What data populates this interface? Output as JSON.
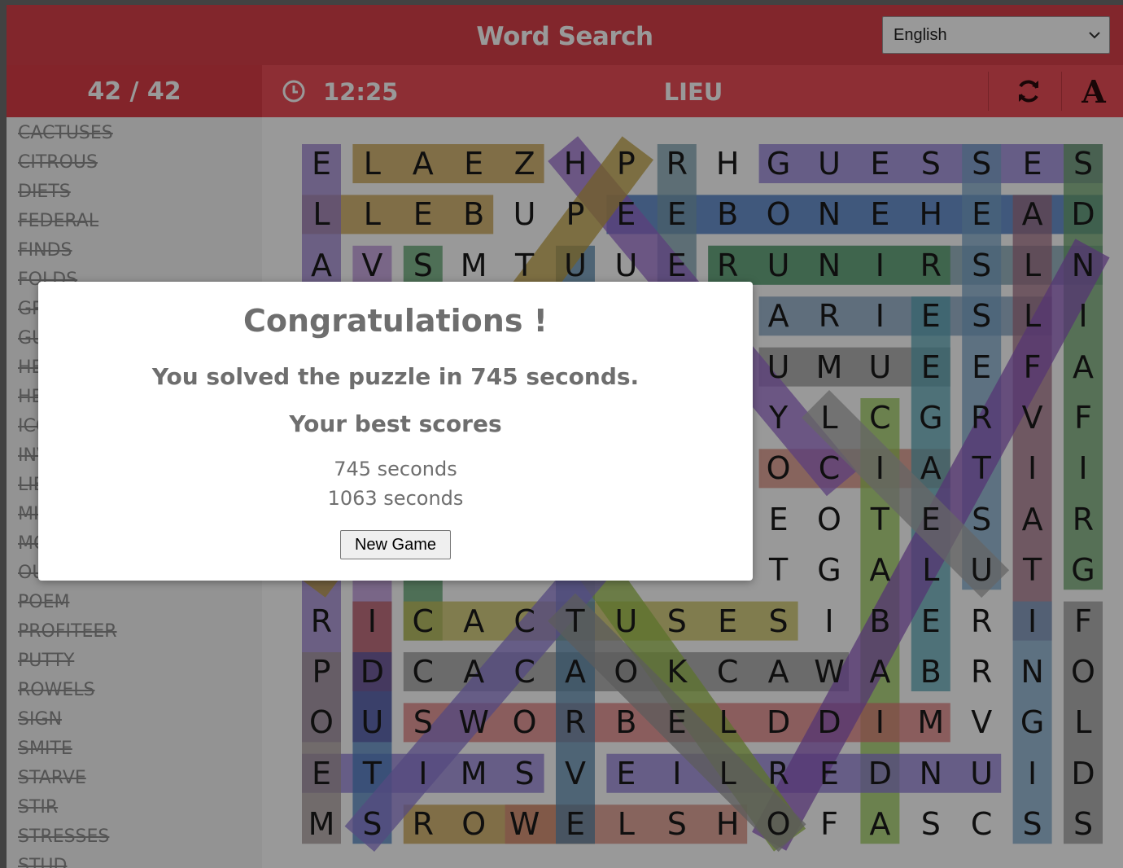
{
  "app": {
    "title": "Word Search"
  },
  "language": {
    "selected": "English"
  },
  "status": {
    "counter": "42 / 42",
    "timer": "12:25",
    "current_word": "LIEU"
  },
  "icons": {
    "clock": "clock-icon",
    "refresh": "refresh-icon",
    "font": "font-size-icon",
    "chevron": "chevron-down-icon"
  },
  "font_button": {
    "label": "A"
  },
  "colors": {
    "header": "#d9404a",
    "counter_bar": "#da3d47",
    "control_bar": "#ec4e57"
  },
  "word_list": [
    "CACTUSES",
    "CITROUS",
    "DIETS",
    "FEDERAL",
    "FINDS",
    "FOLDS",
    "GRIMACE",
    "GUESSES",
    "HEADING",
    "HEAVEN",
    "ICONS",
    "INVITE",
    "LIEU",
    "MIDDLE",
    "MOIST",
    "OUTLET",
    "POEM",
    "PROFITEER",
    "PUTTY",
    "ROWELS",
    "SIGN",
    "SMITE",
    "STARVE",
    "STIR",
    "STRESSES",
    "STUD"
  ],
  "grid": [
    "ELAEZHPRHGUESSES",
    "LLEBUPEEBONEHEAD",
    "AVSMTUUERUNIRSLN",
    "JMSCSQVIGARIESLI",
    "OMTUTIRRLUMUEEFA",
    "SNEIOQIEQYLCGRVF",
    "BVEBQMTSSOCIATII",
    "DTQXPOMEIEOTESAR",
    "HMDFLENTITGALUTG",
    "RICACTUSESIBERIF",
    "PDCACAOKCAWABRNO",
    "OUSWORBELDDIMVGL",
    "ETIMSVEILREDNUID",
    "MSROWELSHOFASCSS"
  ],
  "modal": {
    "title": "Congratulations !",
    "message": "You solved the puzzle in 745 seconds.",
    "best_heading": "Your best scores",
    "scores": [
      "745 seconds",
      "1063 seconds"
    ],
    "new_game_label": "New Game"
  }
}
